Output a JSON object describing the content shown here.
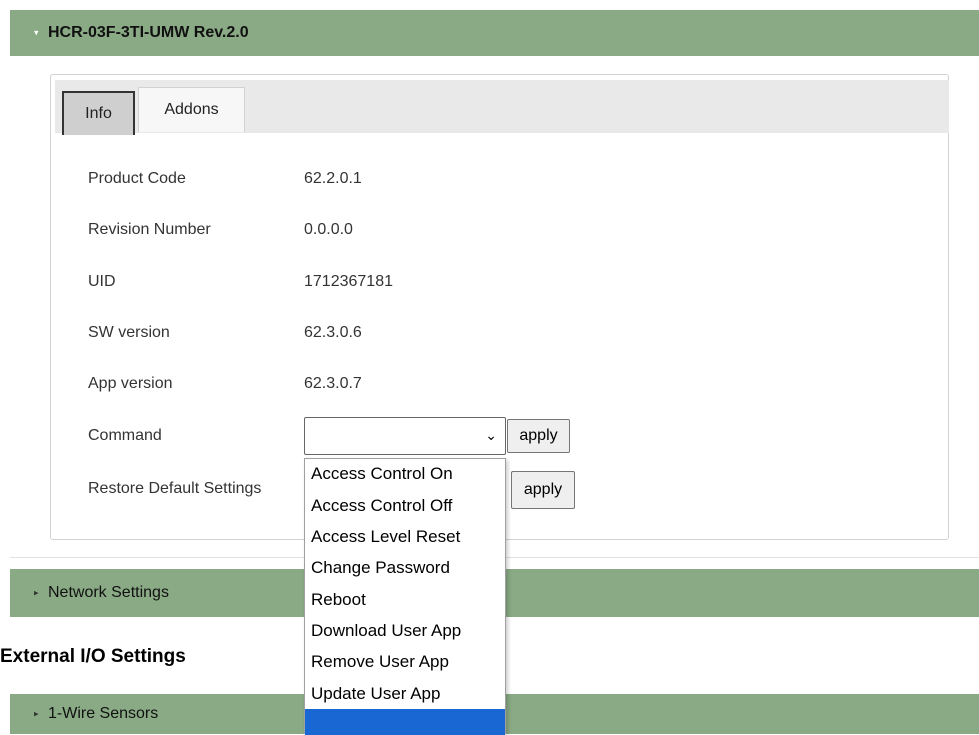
{
  "device_header": {
    "arrow": "▾",
    "title": "HCR-03F-3TI-UMW Rev.2.0"
  },
  "tabs": [
    {
      "label": "Info"
    },
    {
      "label": "Addons"
    }
  ],
  "info_rows": [
    {
      "label": "Product Code",
      "value": "62.2.0.1"
    },
    {
      "label": "Revision Number",
      "value": "0.0.0.0"
    },
    {
      "label": "UID",
      "value": "1712367181"
    },
    {
      "label": "SW version",
      "value": "62.3.0.6"
    },
    {
      "label": "App version",
      "value": "62.3.0.7"
    }
  ],
  "command": {
    "label": "Command",
    "selected": "",
    "caret": "⌄",
    "apply_label": "apply"
  },
  "restore": {
    "label": "Restore Default Settings",
    "apply_label": "apply"
  },
  "command_options": [
    "Access Control On",
    "Access Control Off",
    "Access Level Reset",
    "Change Password",
    "Reboot",
    "Download User App",
    "Remove User App",
    "Update User App"
  ],
  "network_settings": {
    "arrow": "▸",
    "label": "Network Settings"
  },
  "external_io_heading": "External I/O Settings",
  "one_wire": {
    "arrow": "▸",
    "label": "1-Wire Sensors"
  }
}
